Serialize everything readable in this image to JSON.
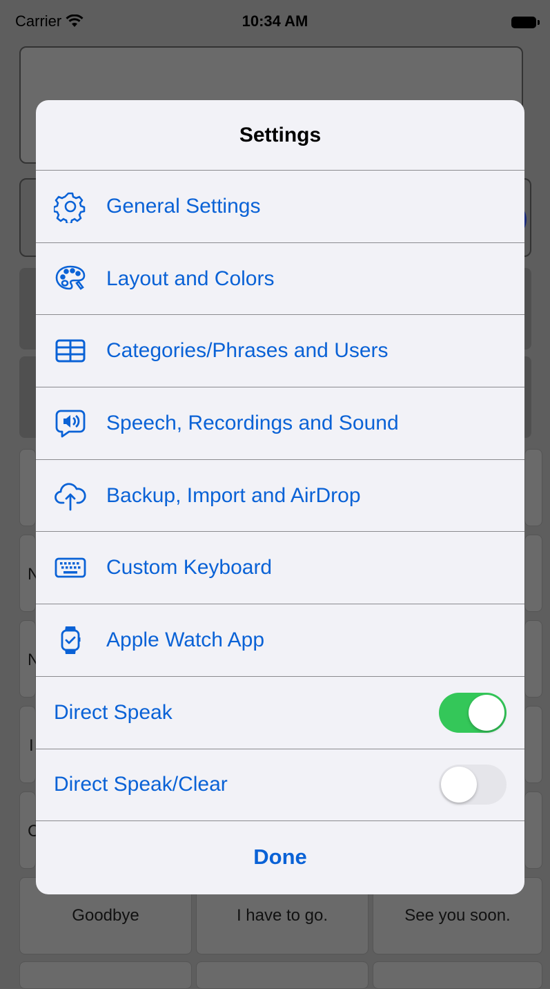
{
  "status_bar": {
    "carrier": "Carrier",
    "time": "10:34 AM"
  },
  "background": {
    "tiles": [
      "Goodbye",
      "I have to go.",
      "See you soon."
    ],
    "side_letters": [
      "N",
      "N",
      "I",
      "C"
    ]
  },
  "settings": {
    "title": "Settings",
    "items": [
      {
        "label": "General Settings",
        "icon": "gear-icon"
      },
      {
        "label": "Layout and Colors",
        "icon": "palette-icon"
      },
      {
        "label": "Categories/Phrases and Users",
        "icon": "table-icon"
      },
      {
        "label": "Speech, Recordings and Sound",
        "icon": "speaker-bubble-icon"
      },
      {
        "label": "Backup, Import and AirDrop",
        "icon": "cloud-upload-icon"
      },
      {
        "label": "Custom Keyboard",
        "icon": "keyboard-icon"
      },
      {
        "label": "Apple Watch App",
        "icon": "watch-icon"
      }
    ],
    "toggles": [
      {
        "label": "Direct Speak",
        "on": true
      },
      {
        "label": "Direct Speak/Clear",
        "on": false
      }
    ],
    "done_label": "Done"
  },
  "colors": {
    "accent": "#0a62d6",
    "switch_on": "#34c759",
    "switch_off": "#e5e5ea"
  }
}
